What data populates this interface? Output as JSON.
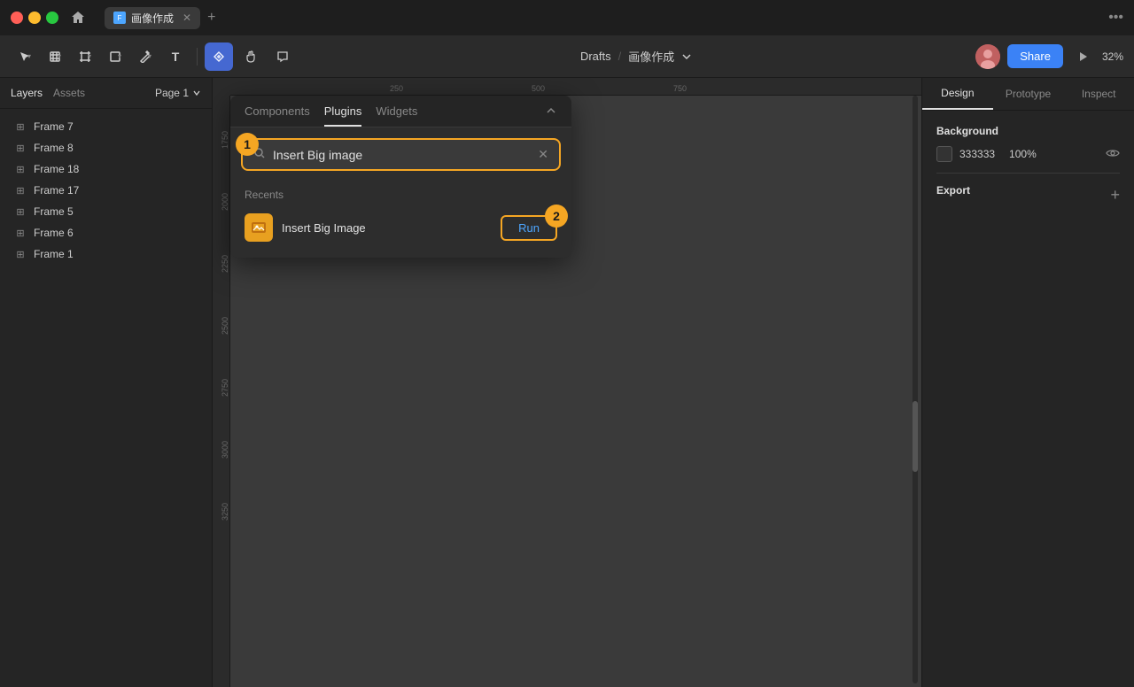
{
  "titleBar": {
    "tabName": "画像作成",
    "addTabLabel": "+",
    "moreLabel": "•••",
    "homeLabel": "⌂"
  },
  "toolbar": {
    "tools": [
      {
        "id": "move",
        "label": "↖",
        "active": false
      },
      {
        "id": "scale",
        "label": "⊞",
        "active": false
      },
      {
        "id": "frame",
        "label": "⬜",
        "active": false
      },
      {
        "id": "shape",
        "label": "◇",
        "active": false
      },
      {
        "id": "pen",
        "label": "✏",
        "active": false
      },
      {
        "id": "text",
        "label": "T",
        "active": false
      },
      {
        "id": "components",
        "label": "⊞",
        "active": true
      },
      {
        "id": "hand",
        "label": "✋",
        "active": false
      },
      {
        "id": "comment",
        "label": "💬",
        "active": false
      }
    ],
    "breadcrumb": {
      "drafts": "Drafts",
      "separator": "/",
      "fileName": "画像作成"
    },
    "shareLabel": "Share",
    "zoomLevel": "32%"
  },
  "leftPanel": {
    "tabs": [
      {
        "id": "layers",
        "label": "Layers",
        "active": true
      },
      {
        "id": "assets",
        "label": "Assets",
        "active": false
      }
    ],
    "pageSelector": "Page 1",
    "layers": [
      {
        "id": "frame7",
        "label": "Frame 7"
      },
      {
        "id": "frame8",
        "label": "Frame 8"
      },
      {
        "id": "frame18",
        "label": "Frame 18"
      },
      {
        "id": "frame17",
        "label": "Frame 17"
      },
      {
        "id": "frame5",
        "label": "Frame 5"
      },
      {
        "id": "frame6",
        "label": "Frame 6"
      },
      {
        "id": "frame1",
        "label": "Frame 1"
      }
    ]
  },
  "pluginsPanel": {
    "tabs": [
      {
        "id": "components",
        "label": "Components",
        "active": false
      },
      {
        "id": "plugins",
        "label": "Plugins",
        "active": true
      },
      {
        "id": "widgets",
        "label": "Widgets",
        "active": false
      }
    ],
    "collapseLabel": "⬆",
    "annotation1": "1",
    "annotation2": "2",
    "search": {
      "placeholder": "Insert Big image",
      "value": "Insert Big image"
    },
    "recentsLabel": "Recents",
    "plugins": [
      {
        "id": "insert-big-image",
        "name": "Insert Big Image",
        "iconLabel": "🖼",
        "runLabel": "Run"
      }
    ]
  },
  "rightPanel": {
    "tabs": [
      {
        "id": "design",
        "label": "Design",
        "active": true
      },
      {
        "id": "prototype",
        "label": "Prototype",
        "active": false
      },
      {
        "id": "inspect",
        "label": "Inspect",
        "active": false
      }
    ],
    "background": {
      "sectionTitle": "Background",
      "colorValue": "333333",
      "opacity": "100%"
    },
    "export": {
      "sectionTitle": "Export",
      "addLabel": "+"
    }
  },
  "ruler": {
    "hMarks": [
      "250",
      "500",
      "750"
    ],
    "vMarks": [
      "1750",
      "2000",
      "2250",
      "2500",
      "2750",
      "3000",
      "3250"
    ]
  }
}
